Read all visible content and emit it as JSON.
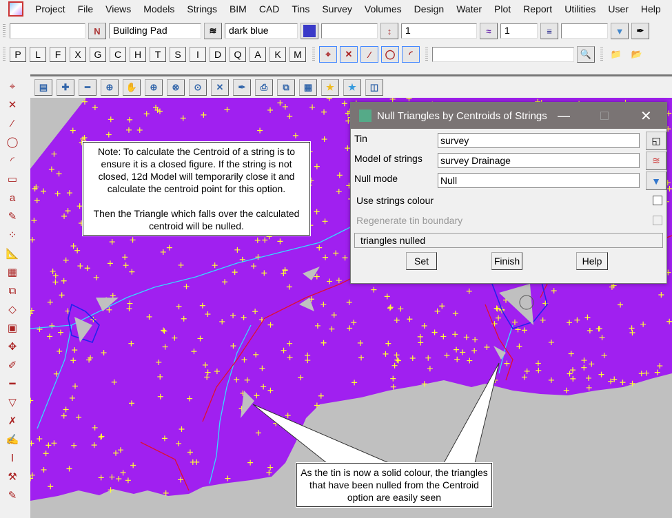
{
  "menu": [
    "Project",
    "File",
    "Views",
    "Models",
    "Strings",
    "BIM",
    "CAD",
    "Tins",
    "Survey",
    "Volumes",
    "Design",
    "Water",
    "Plot",
    "Report",
    "Utilities",
    "User",
    "Help"
  ],
  "toolbar1": {
    "name_value": "",
    "model_value": "Building Pad",
    "colour_value": "dark blue",
    "colour_hex": "#3a3ac8",
    "height_value": "",
    "style_value": "1",
    "weight_value": "1",
    "extra_value": ""
  },
  "toolbar2": {
    "letters": [
      "P",
      "L",
      "F",
      "X",
      "G",
      "C",
      "H",
      "T",
      "S",
      "I",
      "D",
      "Q",
      "A",
      "K",
      "M"
    ],
    "search_value": ""
  },
  "note": {
    "line1": "Note: To calculate the Centroid of a string is to ensure it is a closed figure. If the string is not closed, 12d Model will temporarily close it and calculate the centroid point for this option.",
    "line2": "Then the Triangle which falls over the calculated centroid will be nulled."
  },
  "callout": "As the tin is now a solid colour, the triangles that have been nulled from the Centroid option are easily seen",
  "dialog": {
    "title": "Null Triangles by Centroids of Strings",
    "tin_label": "Tin",
    "tin_value": "survey",
    "model_label": "Model of strings",
    "model_value": "survey Drainage",
    "mode_label": "Null mode",
    "mode_value": "Null",
    "use_colour_label": "Use strings colour",
    "use_colour_checked": false,
    "regen_label": "Regenerate tin boundary",
    "regen_checked": false,
    "status": "triangles nulled",
    "set": "Set",
    "finish": "Finish",
    "help": "Help"
  },
  "colors": {
    "tin": "#a020f0",
    "background": "#c0c0c0",
    "points": "#ffff33"
  }
}
